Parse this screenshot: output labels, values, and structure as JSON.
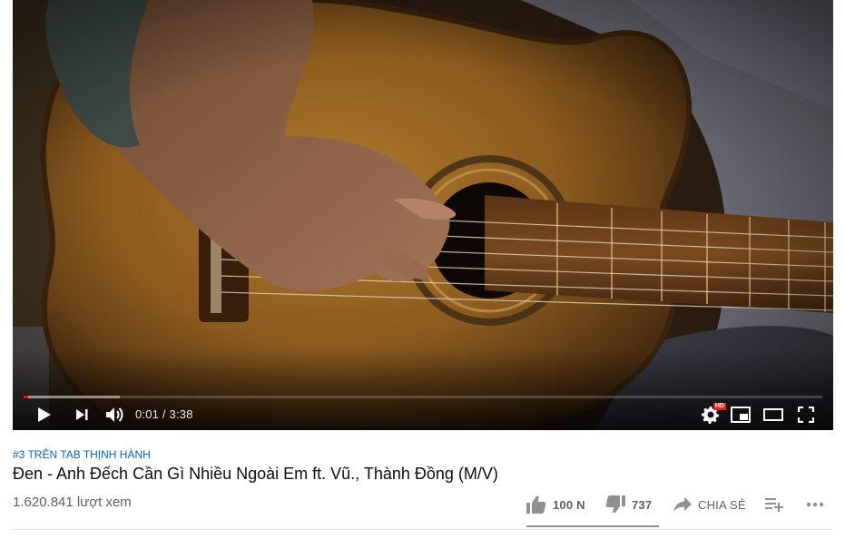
{
  "player": {
    "current_time": "0:01",
    "duration": "3:38",
    "time_separator": "/",
    "played_fraction": 0.006,
    "buffered_fraction": 0.12,
    "hd_badge": "HD",
    "accent_color": "#ff0000"
  },
  "video": {
    "trending_label": "#3 TRÊN TAB THỊNH HÀNH",
    "title": "Đen - Anh Đếch Cần Gì Nhiều Ngoài Em ft. Vũ., Thành Đồng (M/V)",
    "views": "1.620.841 lượt xem"
  },
  "actions": {
    "like_count": "100 N",
    "dislike_count": "737",
    "share_label": "CHIA SẺ",
    "like_ratio": 0.99
  },
  "icons": {
    "play": "play-icon",
    "next": "next-icon",
    "volume": "volume-icon",
    "settings": "gear-icon",
    "miniplayer": "miniplayer-icon",
    "theater": "theater-mode-icon",
    "fullscreen": "fullscreen-icon",
    "like": "thumb-up-icon",
    "dislike": "thumb-down-icon",
    "share": "share-arrow-icon",
    "save": "add-to-playlist-icon",
    "more": "more-horizontal-icon"
  }
}
